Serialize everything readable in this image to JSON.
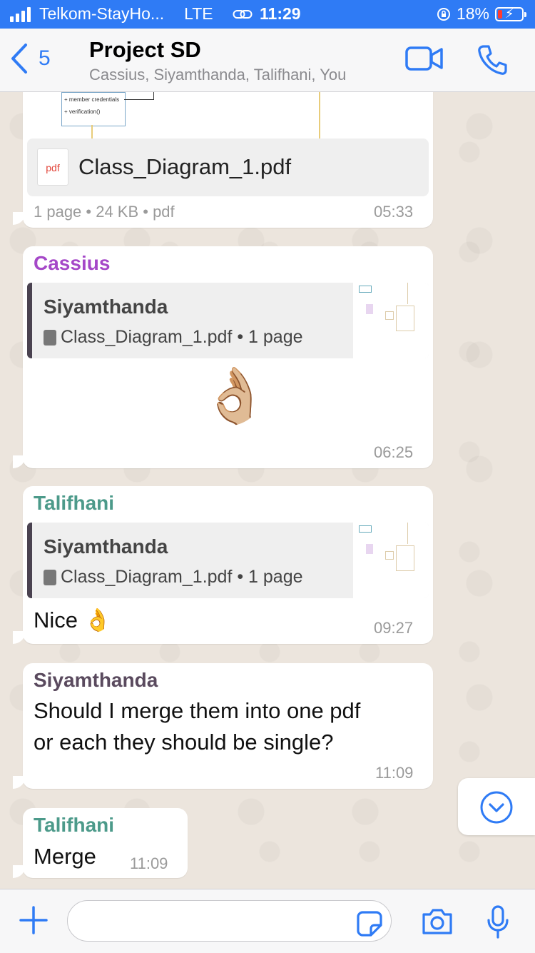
{
  "status": {
    "carrier": "Telkom-StayHo...",
    "network": "LTE",
    "time": "11:29",
    "battery": "18%"
  },
  "header": {
    "back_count": "5",
    "title": "Project SD",
    "subtitle": "Cassius, Siyamthanda, Talifhani, You"
  },
  "messages": {
    "m1": {
      "diagram_line1": "+ member credentials",
      "diagram_line2": "+ verification()",
      "pdf_icon_label": "pdf",
      "file_name": "Class_Diagram_1.pdf",
      "meta": "1 page • 24 KB • pdf",
      "time": "05:33"
    },
    "m2": {
      "sender": "Cassius",
      "sender_color": "#a548c8",
      "quote_name": "Siyamthanda",
      "quote_file": "Class_Diagram_1.pdf • 1 page",
      "emoji": "👌🏼",
      "time": "06:25"
    },
    "m3": {
      "sender": "Talifhani",
      "sender_color": "#4c9a8a",
      "quote_name": "Siyamthanda",
      "quote_file": "Class_Diagram_1.pdf • 1 page",
      "text": "Nice 👌",
      "time": "09:27"
    },
    "m4": {
      "sender": "Siyamthanda",
      "sender_color": "#5a4a5e",
      "line1": "Should I merge them into one pdf",
      "line2": "or each they should be single?",
      "time": "11:09"
    },
    "m5": {
      "sender": "Talifhani",
      "sender_color": "#4c9a8a",
      "text": "Merge",
      "time": "11:09"
    }
  },
  "icons": {
    "back": "chevron-left-icon",
    "video": "video-camera-icon",
    "call": "phone-icon",
    "scroll": "chevron-down-circle-icon",
    "plus": "plus-icon",
    "sticker": "sticker-icon",
    "camera": "camera-icon",
    "mic": "microphone-icon"
  },
  "colors": {
    "accent": "#2f7bf5",
    "battery_low": "#ff3b30",
    "chat_bg": "#ece5dd"
  }
}
